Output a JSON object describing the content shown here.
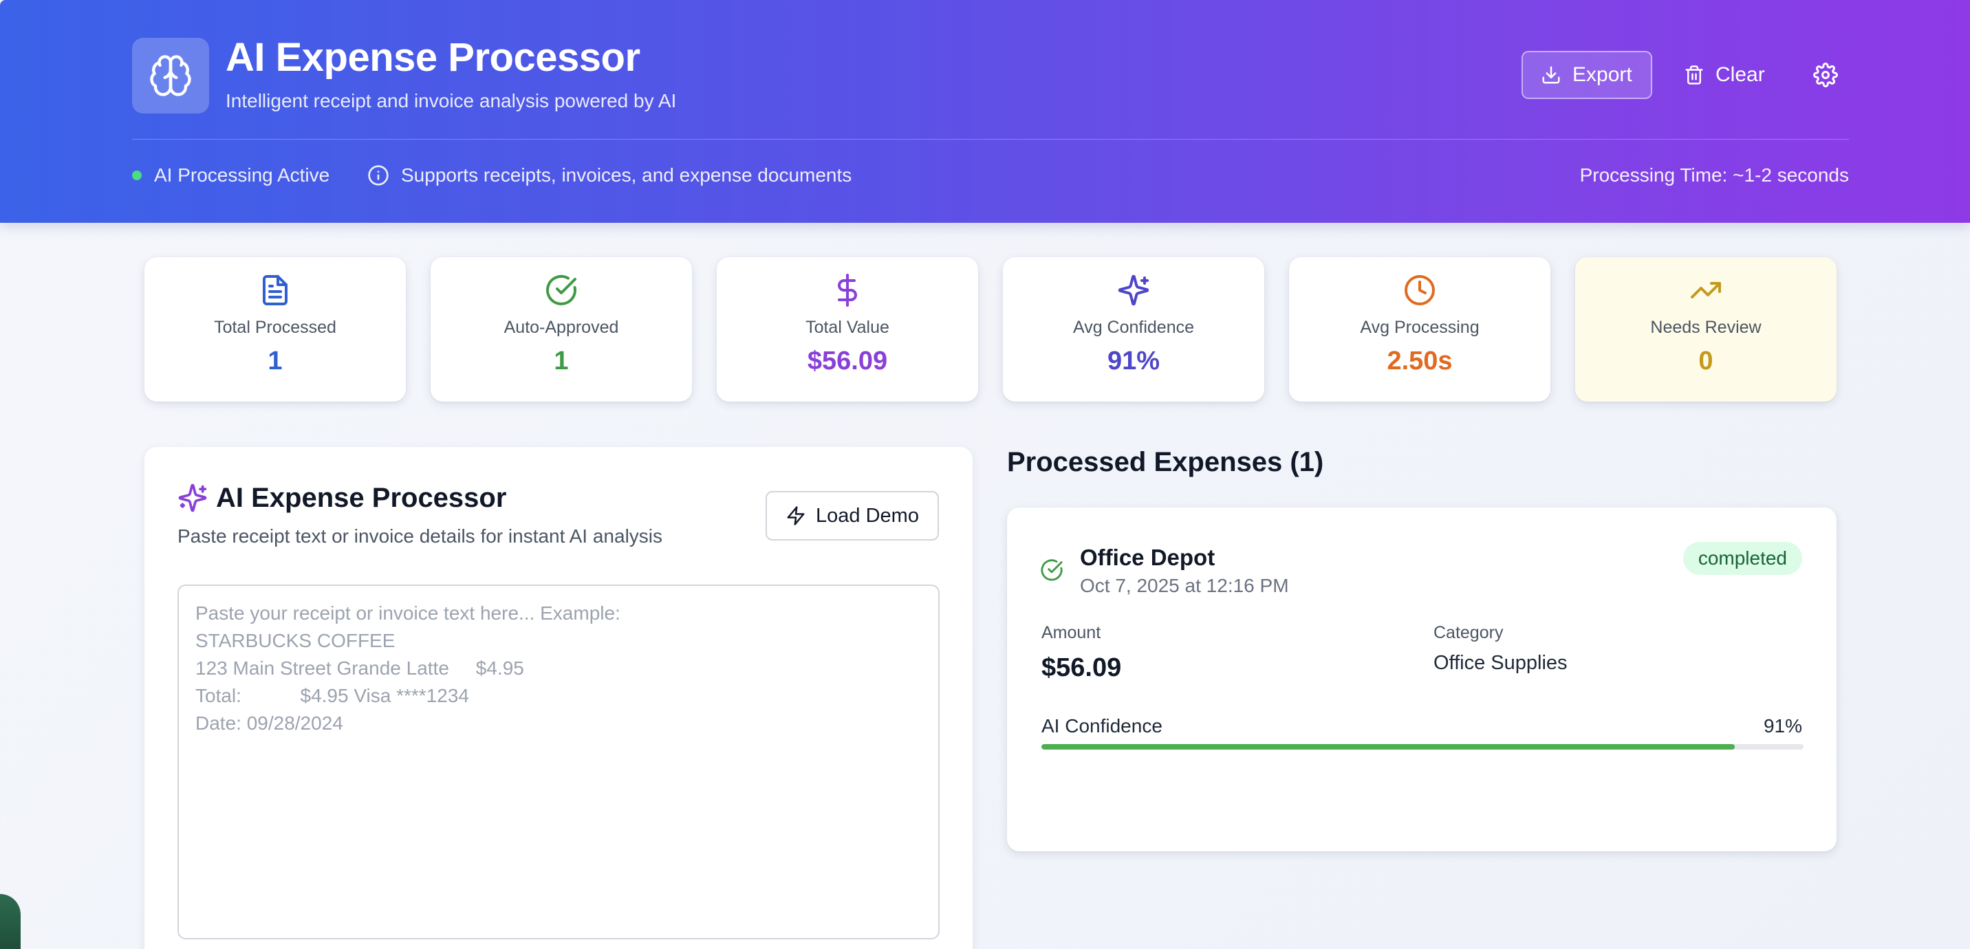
{
  "header": {
    "title": "AI Expense Processor",
    "subtitle": "Intelligent receipt and invoice analysis powered by AI",
    "export_label": "Export",
    "clear_label": "Clear",
    "status_text": "AI Processing Active",
    "info_text": "Supports receipts, invoices, and expense documents",
    "processing_time": "Processing Time: ~1-2 seconds"
  },
  "stats": [
    {
      "label": "Total Processed",
      "value": "1",
      "icon": "document-icon",
      "color": "#2f5fd0"
    },
    {
      "label": "Auto-Approved",
      "value": "1",
      "icon": "check-circle-icon",
      "color": "#3e9a44"
    },
    {
      "label": "Total Value",
      "value": "$56.09",
      "icon": "dollar-icon",
      "color": "#8a3fd6"
    },
    {
      "label": "Avg Confidence",
      "value": "91%",
      "icon": "sparkles-icon",
      "color": "#4f46c8"
    },
    {
      "label": "Avg Processing",
      "value": "2.50s",
      "icon": "clock-icon",
      "color": "#e06a1f"
    },
    {
      "label": "Needs Review",
      "value": "0",
      "icon": "trending-up-icon",
      "color": "#c49a1c"
    }
  ],
  "processor": {
    "title": "AI Expense Processor",
    "subtitle": "Paste receipt text or invoice details for instant AI analysis",
    "demo_label": "Load Demo",
    "placeholder": "Paste your receipt or invoice text here... Example:\nSTARBUCKS COFFEE\n123 Main Street Grande Latte     $4.95\nTotal:           $4.95 Visa ****1234\nDate: 09/28/2024"
  },
  "expenses": {
    "heading": "Processed Expenses (1)",
    "items": [
      {
        "vendor": "Office Depot",
        "date": "Oct 7, 2025 at 12:16 PM",
        "status": "completed",
        "amount_label": "Amount",
        "amount": "$56.09",
        "category_label": "Category",
        "category": "Office Supplies",
        "confidence_label": "AI Confidence",
        "confidence_text": "91%",
        "confidence": 0.91
      }
    ]
  }
}
